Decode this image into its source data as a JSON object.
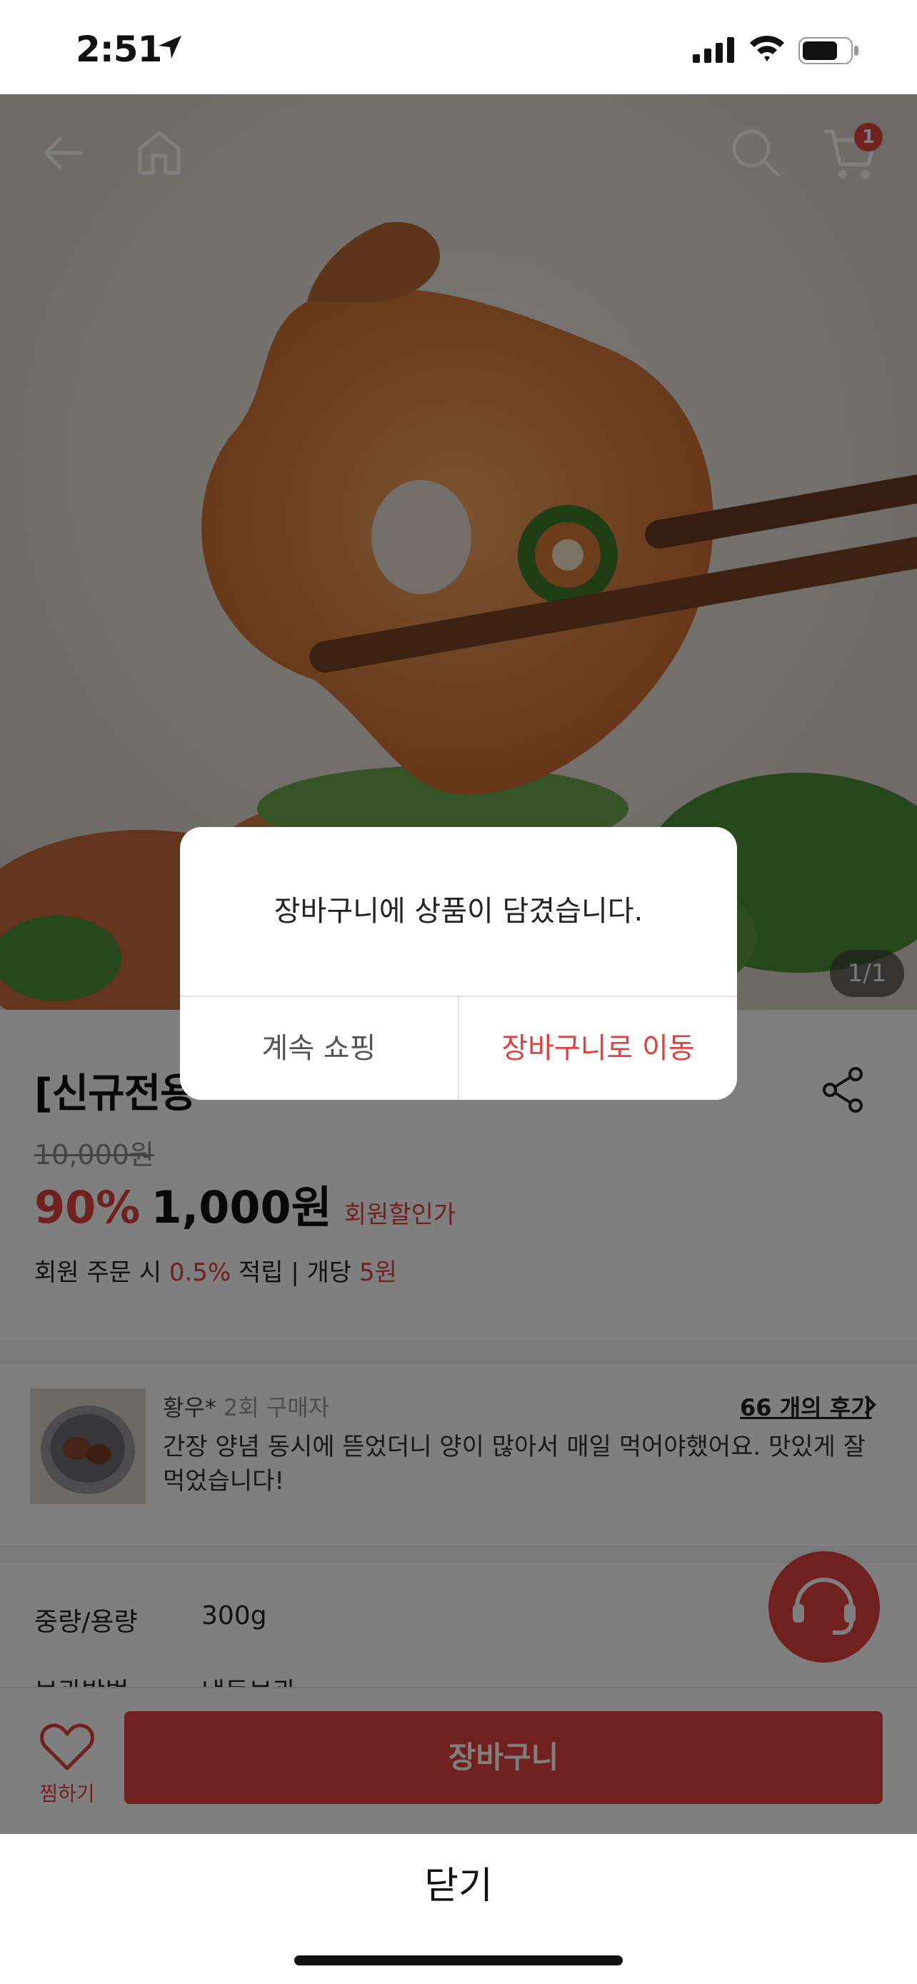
{
  "status_bar": {
    "time": "2:51"
  },
  "top_nav": {
    "cart_count": "1"
  },
  "hero": {
    "image_counter": "1/1"
  },
  "product": {
    "title": "[신규전용",
    "original_price": "10,000원",
    "discount": "90%",
    "price": "1,000원",
    "member_price_label": "회원할인가",
    "points_prefix": "회원 주문 시 ",
    "points_rate": "0.5%",
    "points_middle": " 적립 | 개당 ",
    "points_amount": "5원"
  },
  "review": {
    "author": "황우*",
    "buyer_badge": "2회 구매자",
    "count_link": "66 개의 후기",
    "text": "간장 양념 동시에 뜯었더니 양이 많아서 매일 먹어야했어요. 맛있게 잘 먹었습니다!"
  },
  "specs": [
    {
      "label": "중량/용량",
      "value": "300g"
    },
    {
      "label": "보관방법",
      "value": "냉동보관"
    }
  ],
  "bottom_bar": {
    "wish_label": "찜하기",
    "cart_button": "장바구니"
  },
  "dialog": {
    "message": "장바구니에 상품이 담겼습니다.",
    "continue_button": "계속 쇼핑",
    "go_cart_button": "장바구니로 이동"
  },
  "close_bar": {
    "label": "닫기"
  },
  "colors": {
    "accent": "#e0413f",
    "overlay": "rgba(0,0,0,0.5)"
  }
}
